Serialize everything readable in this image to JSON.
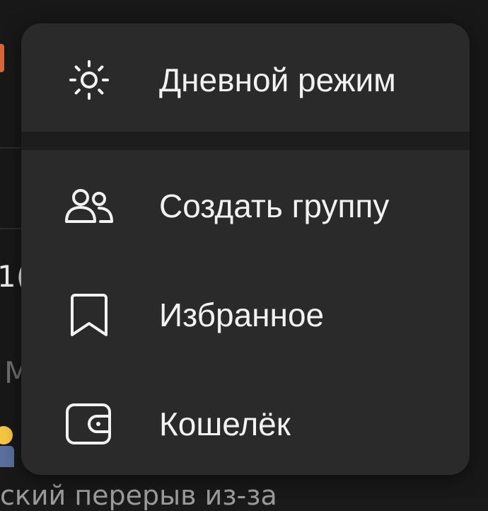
{
  "background": {
    "partial_number": "1(",
    "partial_letter": "M",
    "partial_bottom_text": "ский перерыв из-за"
  },
  "menu": {
    "items": [
      {
        "label": "Дневной режим",
        "icon": "sun-icon"
      },
      {
        "label": "Создать группу",
        "icon": "people-icon"
      },
      {
        "label": "Избранное",
        "icon": "bookmark-icon"
      },
      {
        "label": "Кошелёк",
        "icon": "wallet-icon"
      }
    ]
  },
  "colors": {
    "menu_background": "#2a2a2a",
    "separator": "#1d1d1d",
    "text": "#f2f2f2",
    "accent": "#d8643a"
  }
}
